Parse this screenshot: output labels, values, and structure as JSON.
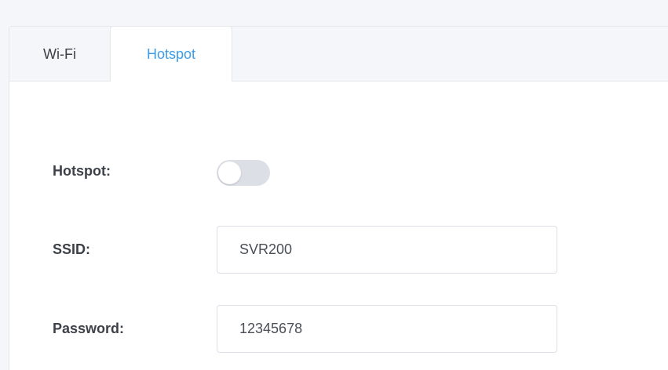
{
  "tabs": [
    {
      "label": "Wi-Fi",
      "active": false
    },
    {
      "label": "Hotspot",
      "active": true
    }
  ],
  "form": {
    "hotspot_label": "Hotspot:",
    "hotspot_enabled": false,
    "ssid_label": "SSID:",
    "ssid_value": "SVR200",
    "password_label": "Password:",
    "password_value": "12345678"
  },
  "colors": {
    "active_tab": "#3d9be9",
    "background": "#f4f6f9",
    "toggle_off": "#dcdfe6"
  }
}
